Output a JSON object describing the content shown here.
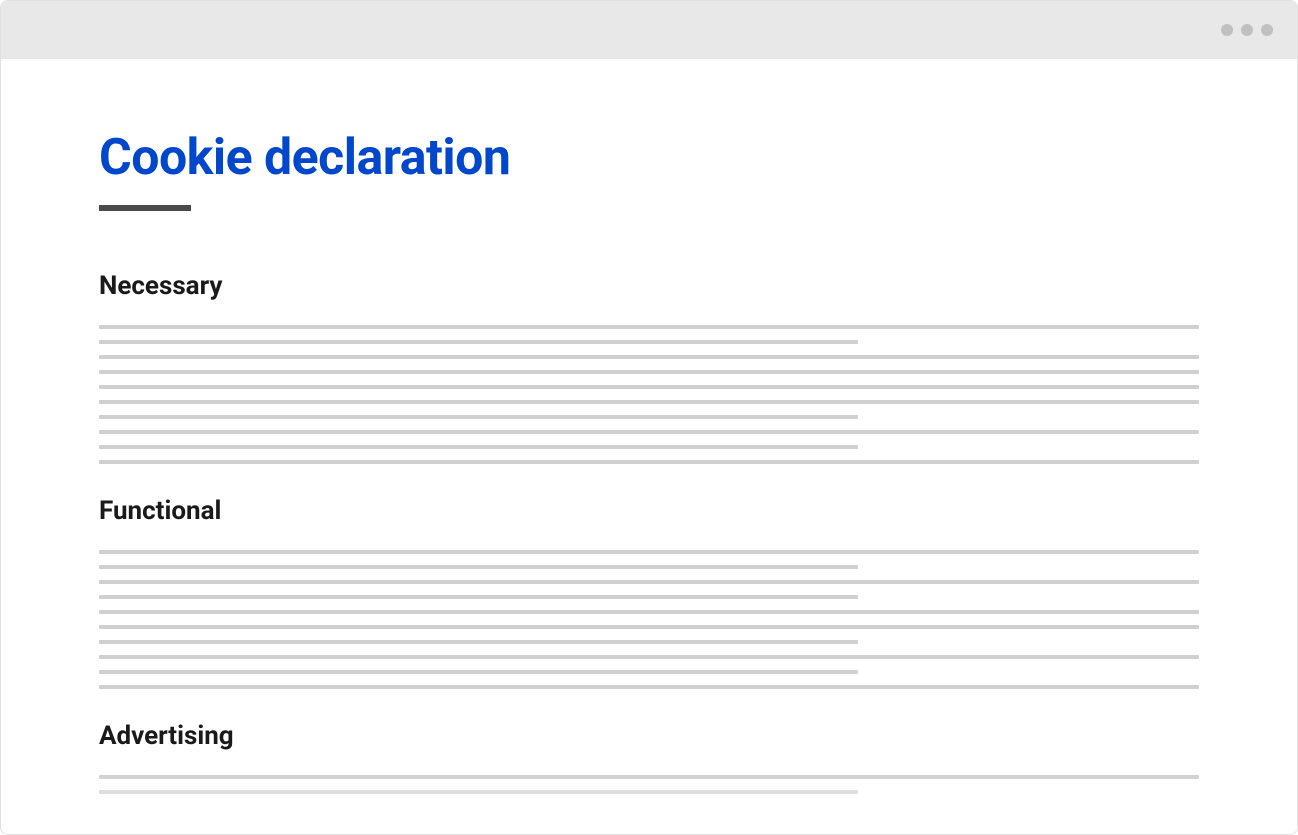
{
  "page": {
    "title": "Cookie declaration"
  },
  "sections": [
    {
      "heading": "Necessary"
    },
    {
      "heading": "Functional"
    },
    {
      "heading": "Advertising"
    }
  ]
}
